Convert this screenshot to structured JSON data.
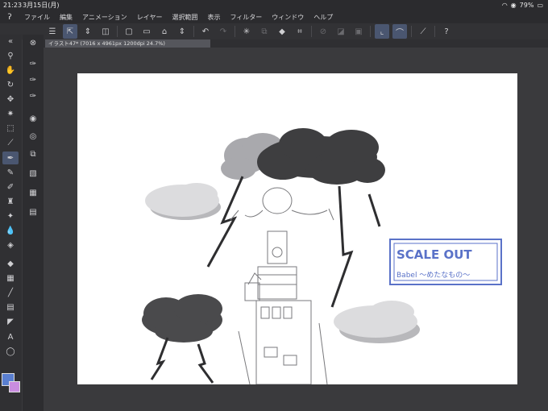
{
  "status": {
    "time": "21:23",
    "date": "3月15日(月)",
    "battery": "79%"
  },
  "menu": [
    "ファイル",
    "編集",
    "アニメーション",
    "レイヤー",
    "選択範囲",
    "表示",
    "フィルター",
    "ウィンドウ",
    "ヘルプ"
  ],
  "tab": {
    "title": "イラスト47* (7016 x 4961px 1200dpi 24.7%)"
  },
  "colors": {
    "main": "#5a7fd0",
    "sub": "#c98de0",
    "canvas": "#ffffff",
    "logo_blue": "#5a72c8"
  },
  "artwork": {
    "logo_title": "SCALE OUT",
    "logo_sub": "Babel ～めたなもの～"
  }
}
